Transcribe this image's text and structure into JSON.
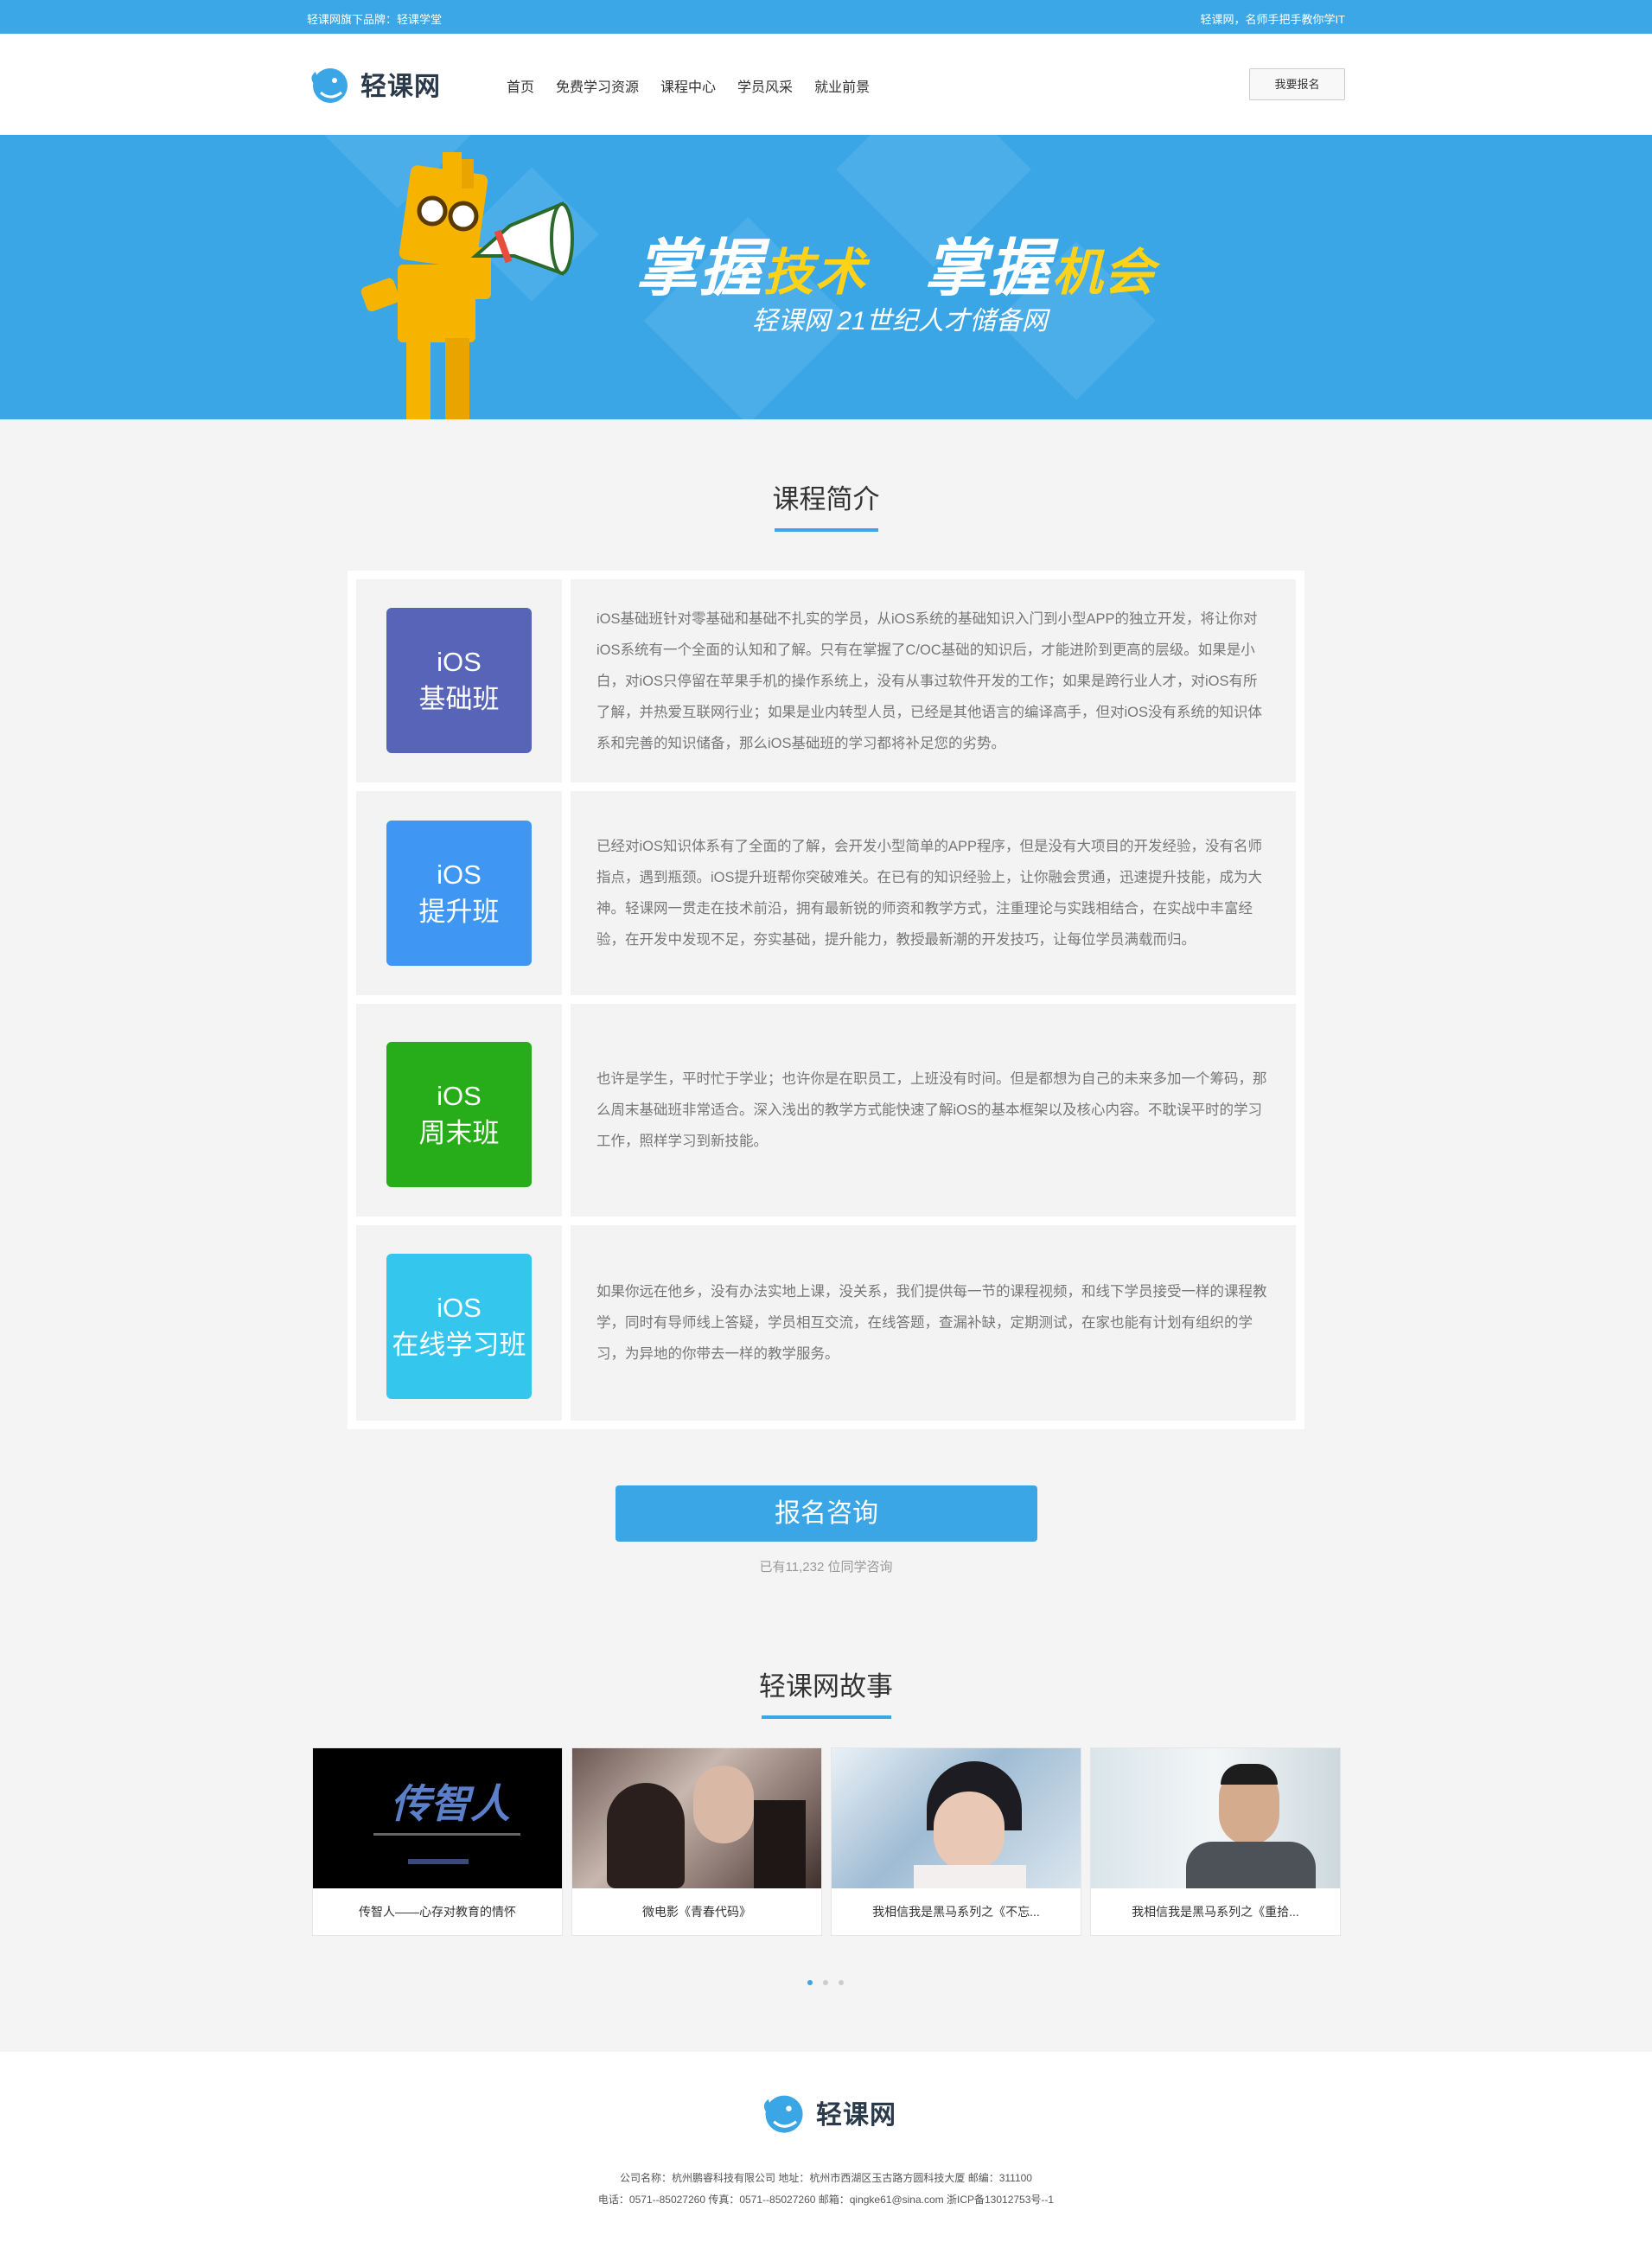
{
  "topbar": {
    "left": "轻课网旗下品牌：轻课学堂",
    "right": "轻课网，名师手把手教你学IT"
  },
  "header": {
    "logo_text": "轻课网",
    "nav": [
      "首页",
      "免费学习资源",
      "课程中心",
      "学员风采",
      "就业前景"
    ],
    "signup": "我要报名"
  },
  "banner": {
    "slogan_a1": "掌握",
    "slogan_a2": "技术",
    "slogan_b1": "掌握",
    "slogan_b2": "机会",
    "subtitle": "轻课网 21世纪人才储备网"
  },
  "intro": {
    "title": "课程简介",
    "courses": [
      {
        "line1": "iOS",
        "line2": "基础班",
        "color": "#5764b8",
        "desc": "iOS基础班针对零基础和基础不扎实的学员，从iOS系统的基础知识入门到小型APP的独立开发，将让你对iOS系统有一个全面的认知和了解。只有在掌握了C/OC基础的知识后，才能进阶到更高的层级。如果是小白，对iOS只停留在苹果手机的操作系统上，没有从事过软件开发的工作；如果是跨行业人才，对iOS有所了解，并热爱互联网行业；如果是业内转型人员，已经是其他语言的编译高手，但对iOS没有系统的知识体系和完善的知识储备，那么iOS基础班的学习都将补足您的劣势。"
      },
      {
        "line1": "iOS",
        "line2": "提升班",
        "color": "#3f97f3",
        "desc": "已经对iOS知识体系有了全面的了解，会开发小型简单的APP程序，但是没有大项目的开发经验，没有名师指点，遇到瓶颈。iOS提升班帮你突破难关。在已有的知识经验上，让你融会贯通，迅速提升技能，成为大神。轻课网一贯走在技术前沿，拥有最新锐的师资和教学方式，注重理论与实践相结合，在实战中丰富经验，在开发中发现不足，夯实基础，提升能力，教授最新潮的开发技巧，让每位学员满载而归。"
      },
      {
        "line1": "iOS",
        "line2": "周末班",
        "color": "#27ad19",
        "desc": "也许是学生，平时忙于学业；也许你是在职员工，上班没有时间。但是都想为自己的未来多加一个筹码，那么周末基础班非常适合。深入浅出的教学方式能快速了解iOS的基本框架以及核心内容。不耽误平时的学习工作，照样学习到新技能。"
      },
      {
        "line1": "iOS",
        "line2": "在线学习班",
        "color": "#34c6ec",
        "desc": "如果你远在他乡，没有办法实地上课，没关系，我们提供每一节的课程视频，和线下学员接受一样的课程教学，同时有导师线上答疑，学员相互交流，在线答题，查漏补缺，定期测试，在家也能有计划有组织的学习，为异地的你带去一样的教学服务。"
      }
    ]
  },
  "cta": {
    "button": "报名咨询",
    "note": "已有11,232 位同学咨询"
  },
  "stories": {
    "title": "轻课网故事",
    "items": [
      {
        "caption": "传智人——心存对教育的情怀",
        "thumb_text": "传智人"
      },
      {
        "caption": "微电影《青春代码》"
      },
      {
        "caption": "我相信我是黑马系列之《不忘..."
      },
      {
        "caption": "我相信我是黑马系列之《重拾..."
      }
    ]
  },
  "footer": {
    "logo_text": "轻课网",
    "line1": "公司名称：杭州鹏睿科技有限公司    地址：杭州市西湖区玉古路方圆科技大厦    邮编：311100",
    "line2": "电话：0571--85027260    传真：0571--85027260    邮箱：qingke61@sina.com    浙ICP备13012753号--1"
  }
}
